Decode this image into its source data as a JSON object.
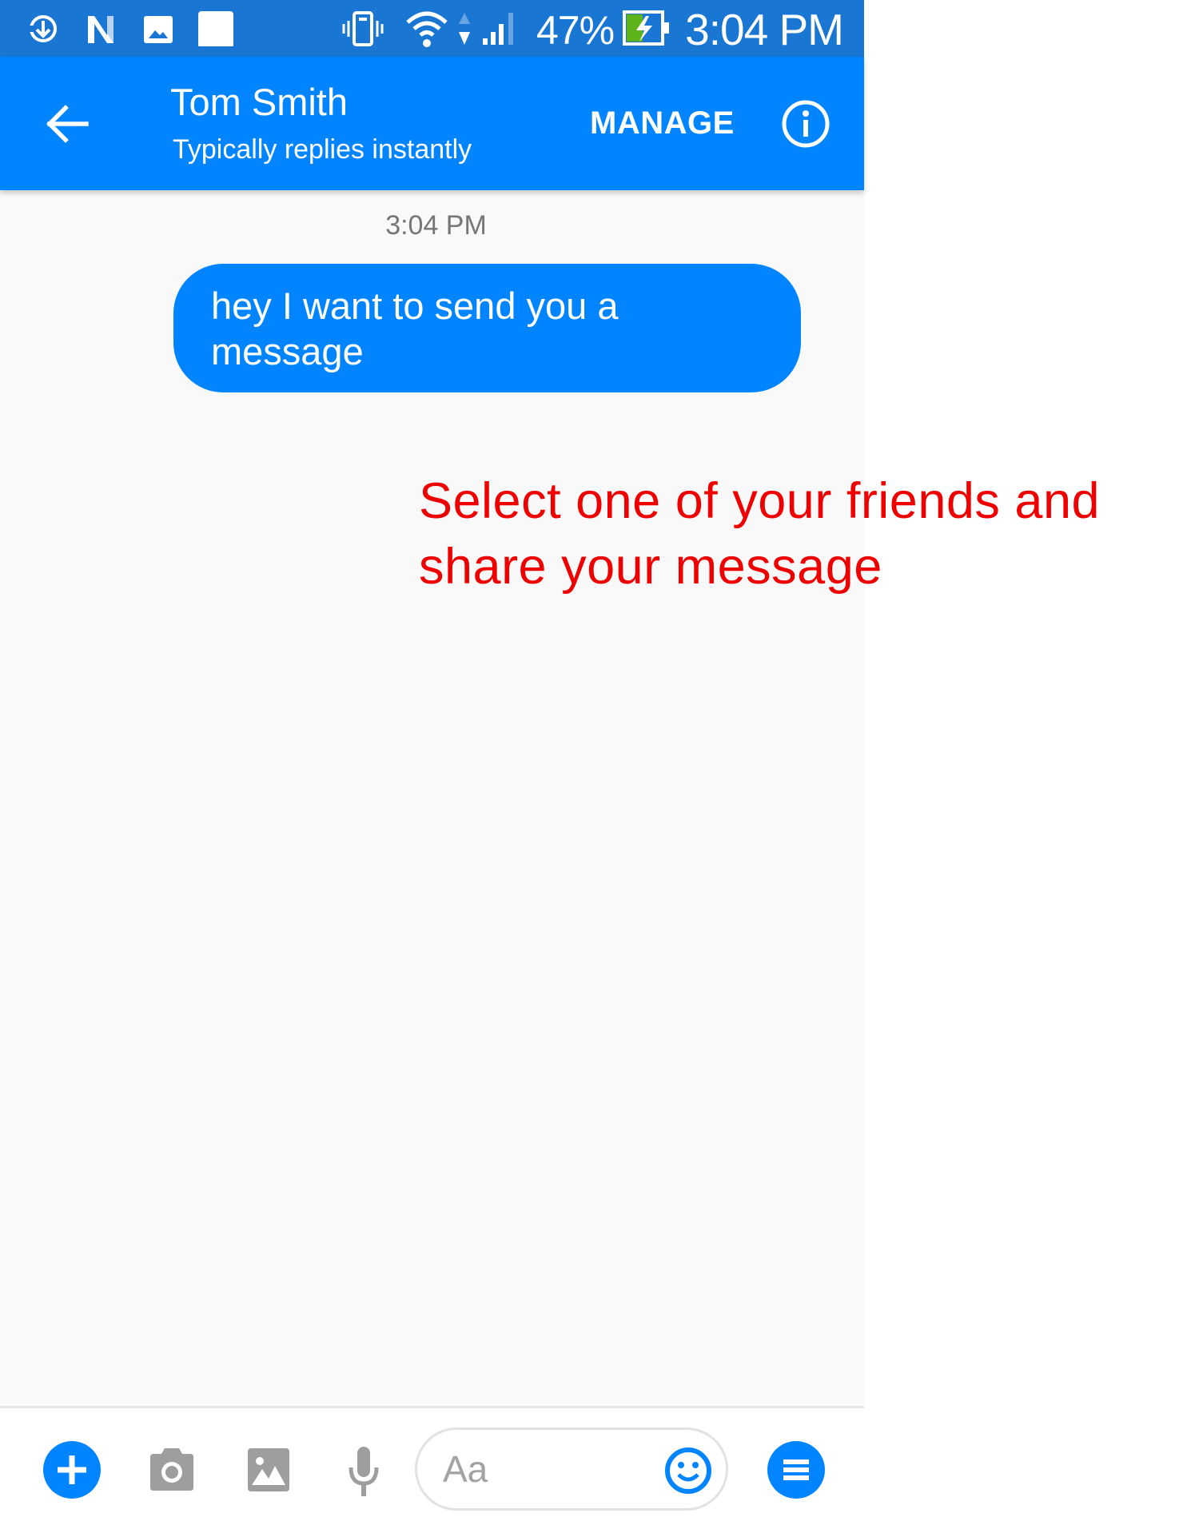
{
  "status_bar": {
    "left_icons": [
      "download-sync-icon",
      "n-notification-icon",
      "image-notification-icon",
      "blank-notification-icon"
    ],
    "right_icons": [
      "vibrate-icon",
      "wifi-icon",
      "data-transfer-icon",
      "signal-icon",
      "battery-charging-icon"
    ],
    "battery_percent": "47%",
    "time": "3:04 PM",
    "colors": {
      "background": "#1976d2",
      "battery_fill": "#5db31a"
    }
  },
  "header": {
    "back_icon": "arrow-left-icon",
    "title": "Tom Smith",
    "subtitle": "Typically replies instantly",
    "manage_label": "MANAGE",
    "info_icon": "info-icon",
    "colors": {
      "background": "#0084ff",
      "text": "#ffffff"
    }
  },
  "conversation": {
    "timestamp": "3:04 PM",
    "messages": [
      {
        "sender": "me",
        "text": "hey I want to send you a message"
      }
    ],
    "colors": {
      "background": "#f9f9f9",
      "bubble": "#0084ff",
      "bubble_text": "#ffffff"
    }
  },
  "annotation": {
    "text": "Select one of your friends and share your message",
    "color": "#ee0000"
  },
  "composer": {
    "buttons": [
      {
        "name": "more-actions",
        "icon": "plus-icon"
      },
      {
        "name": "camera",
        "icon": "camera-icon"
      },
      {
        "name": "gallery",
        "icon": "image-icon"
      },
      {
        "name": "voice",
        "icon": "microphone-icon"
      }
    ],
    "input_placeholder": "Aa",
    "emoji_icon": "smiley-icon",
    "menu_icon": "menu-icon",
    "colors": {
      "accent": "#0084ff",
      "icon_gray": "#9e9e9e"
    }
  }
}
